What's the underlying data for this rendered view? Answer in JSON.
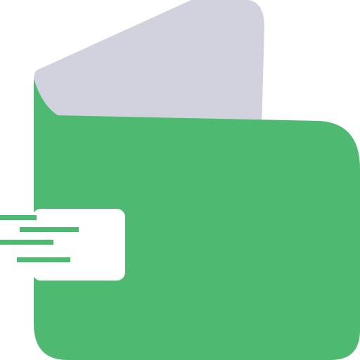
{
  "icon": {
    "name": "wallet-icon",
    "colors": {
      "back_panel": "#D2D2DE",
      "body": "#4DB971",
      "flap": "#FFFFFF",
      "speed_lines": "#4DB971"
    }
  }
}
